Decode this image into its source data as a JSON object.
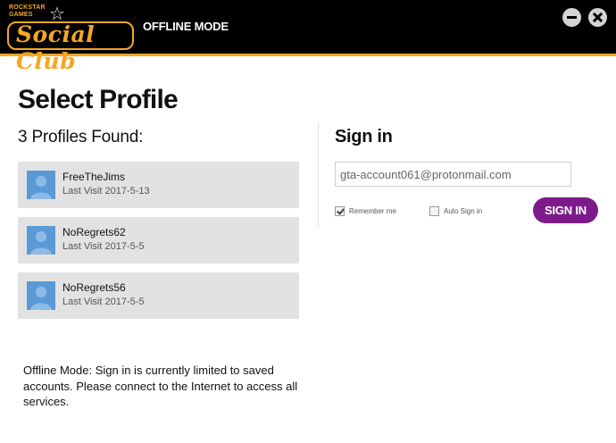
{
  "header": {
    "logo_small_line1": "ROCKSTAR",
    "logo_small_line2": "GAMES",
    "logo_script": "Social Club",
    "mode_label": "OFFLINE MODE",
    "accent_color": "#f5a623"
  },
  "window_controls": {
    "minimize_icon": "minus-circle-icon",
    "close_icon": "x-circle-icon"
  },
  "main": {
    "title": "Select Profile",
    "profiles_found": "3 Profiles Found:",
    "profiles": [
      {
        "name": "FreeTheJims",
        "last_visit": "Last Visit 2017-5-13"
      },
      {
        "name": "NoRegrets62",
        "last_visit": "Last Visit 2017-5-5"
      },
      {
        "name": "NoRegrets56",
        "last_visit": "Last Visit 2017-5-5"
      }
    ],
    "offline_note": "Offline Mode: Sign in is currently limited to saved accounts. Please connect to the Internet to access all services."
  },
  "signin": {
    "title": "Sign in",
    "email_value": "gta-account061@protonmail.com",
    "remember_label": "Remember me",
    "remember_checked": true,
    "auto_label": "Auto Sign in",
    "auto_checked": false,
    "button_label": "SIGN IN",
    "button_color": "#7d1a8a"
  }
}
